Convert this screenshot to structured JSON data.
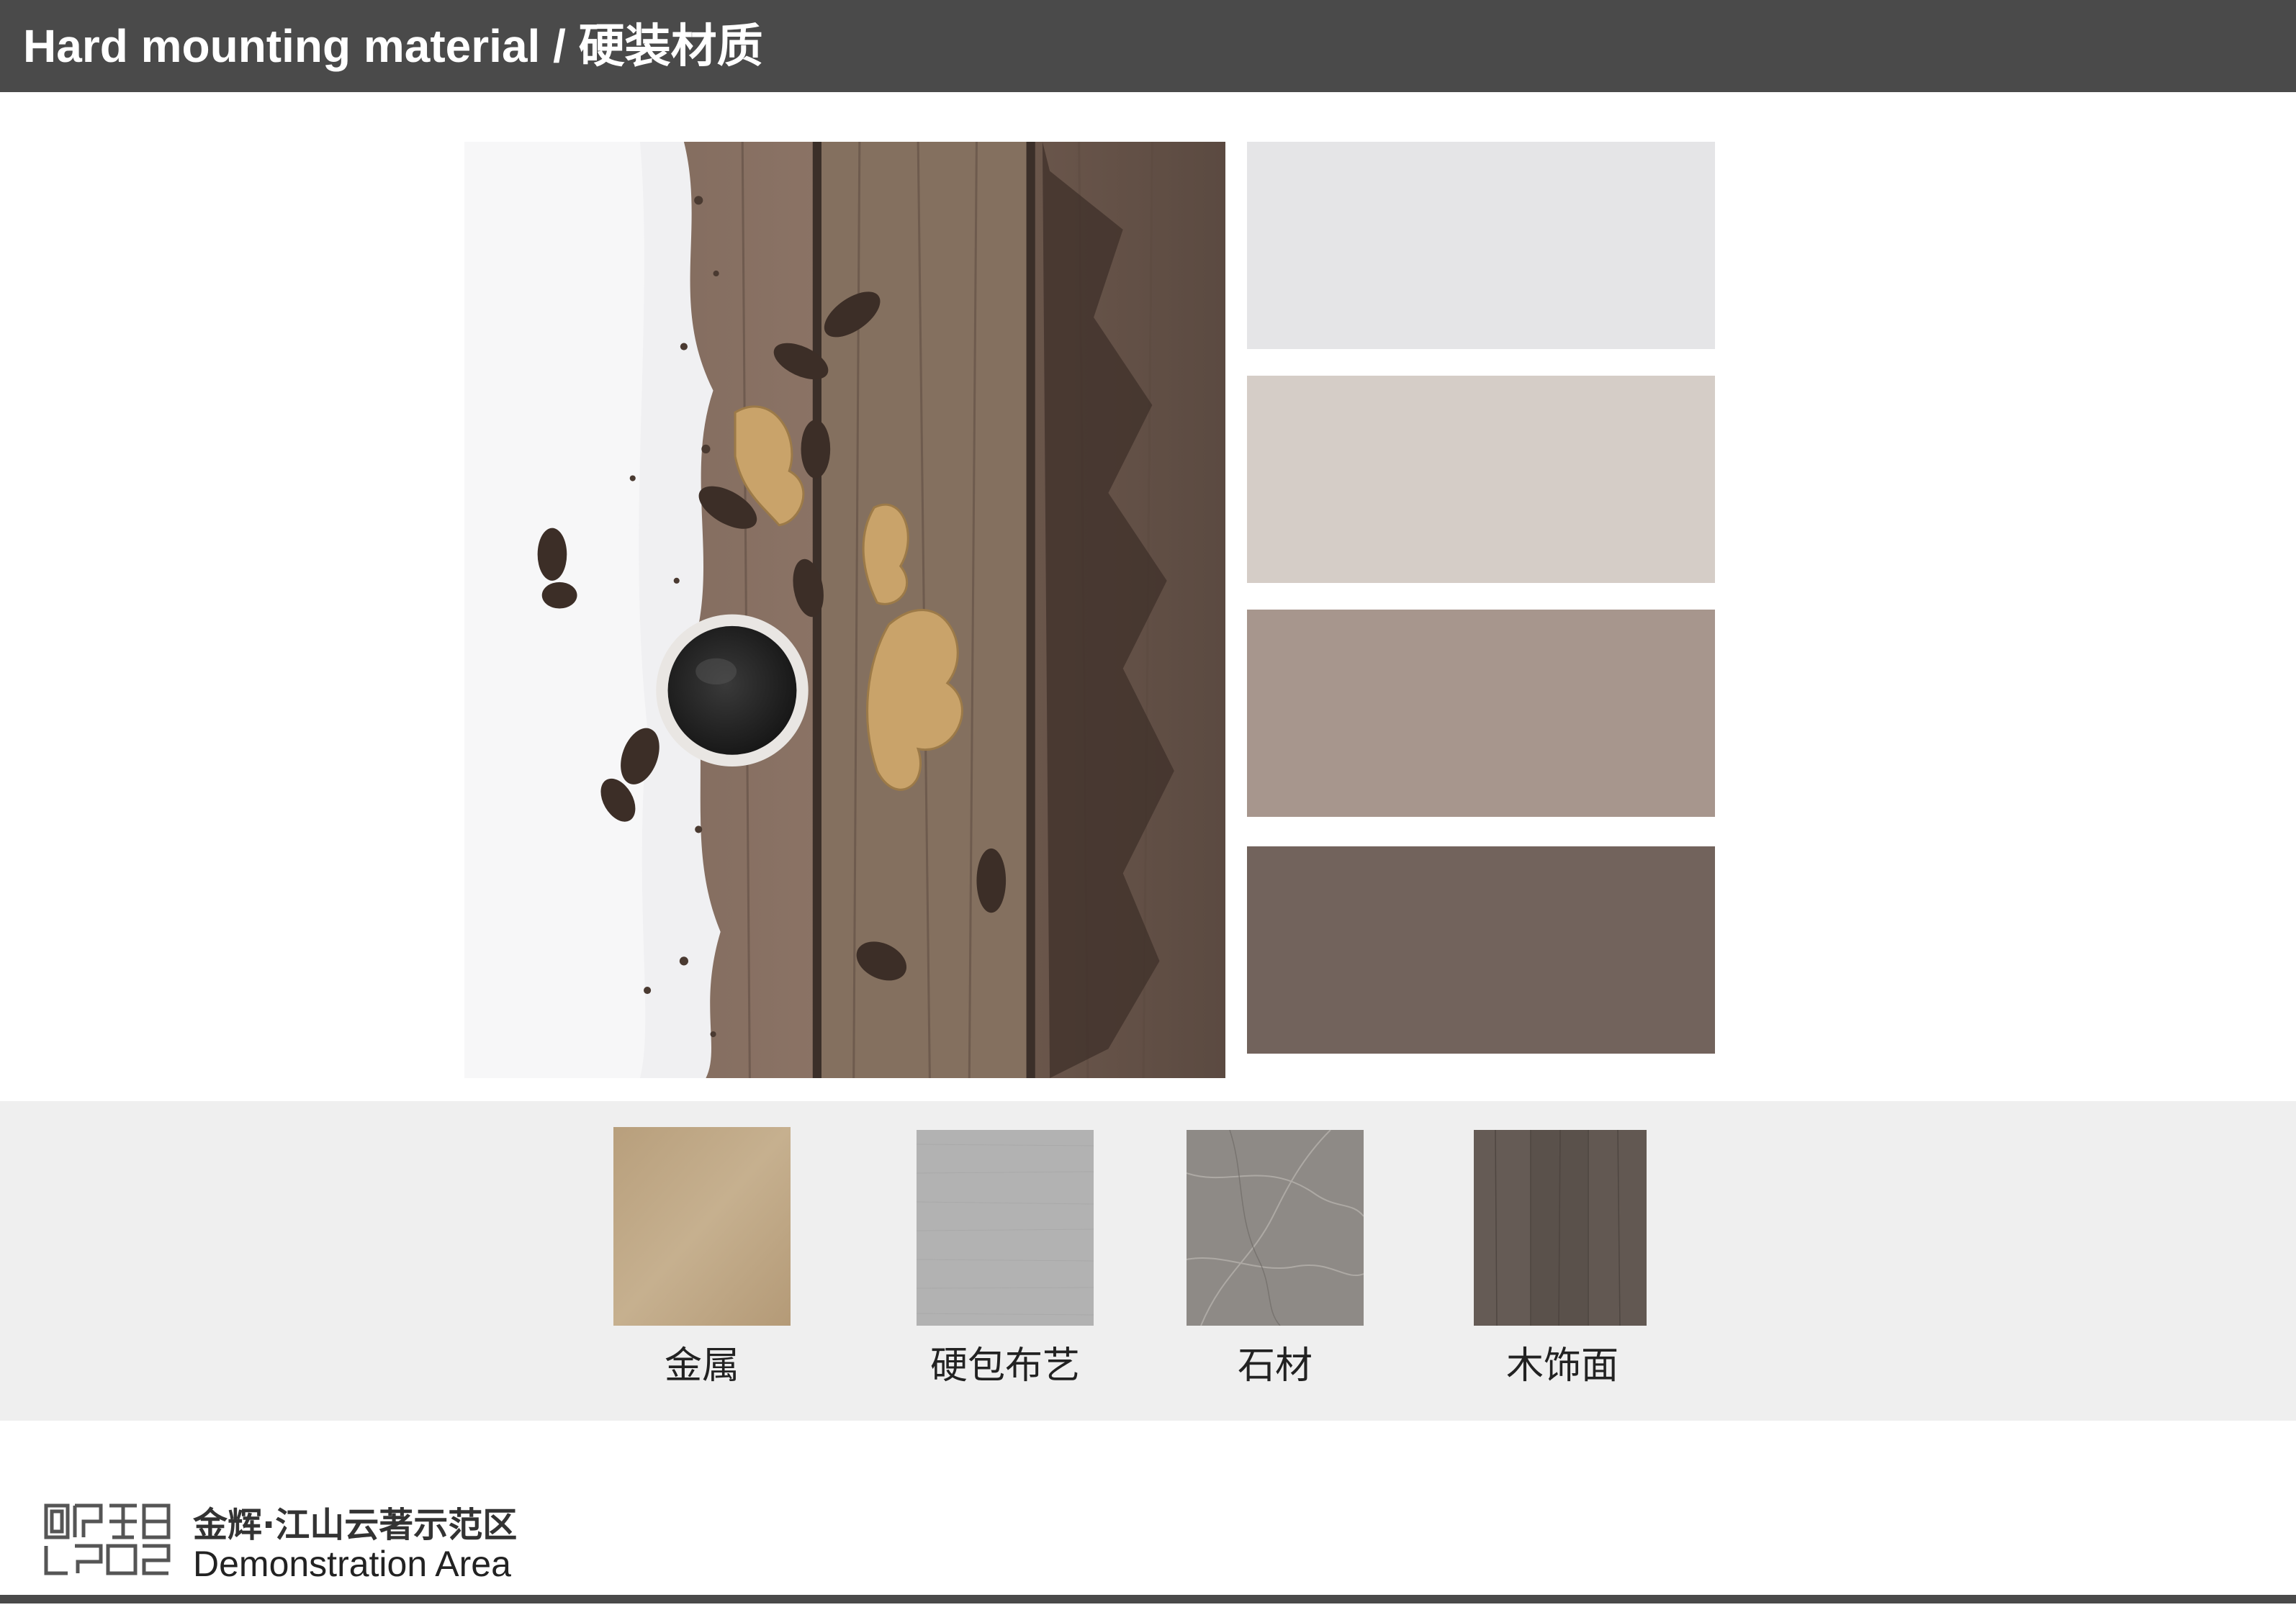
{
  "header": {
    "title": "Hard mounting material / 硬装材质"
  },
  "palette": {
    "swatches": [
      {
        "color": "#e5e5e7"
      },
      {
        "color": "#d5cdc7"
      },
      {
        "color": "#a7968d"
      },
      {
        "color": "#72635c"
      }
    ]
  },
  "materials": {
    "items": [
      {
        "label": "金属",
        "color": "#c1aa88"
      },
      {
        "label": "硬包布艺",
        "color": "#b1b1b1"
      },
      {
        "label": "石材",
        "color": "#8f8c88"
      },
      {
        "label": "木饰面",
        "color": "#5e5550"
      }
    ]
  },
  "footer": {
    "brand_name": "金辉·江山云著示范区",
    "brand_sub": "Demonstration Area"
  }
}
